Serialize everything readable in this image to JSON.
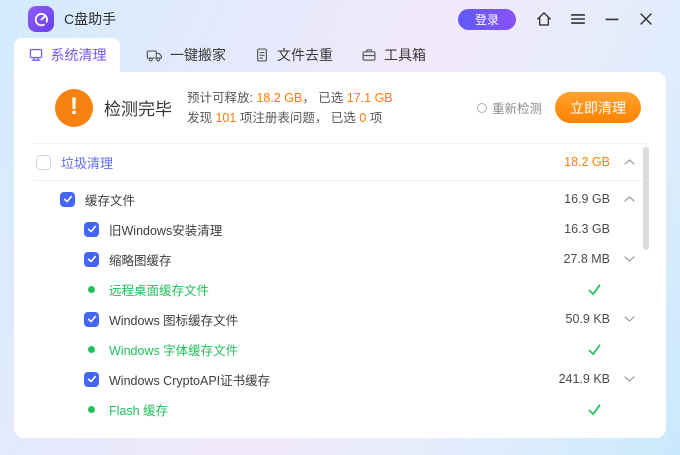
{
  "titlebar": {
    "app_title": "C盘助手",
    "login_label": "登录"
  },
  "tabs": [
    {
      "label": "系统清理"
    },
    {
      "label": "一键搬家"
    },
    {
      "label": "文件去重"
    },
    {
      "label": "工具箱"
    }
  ],
  "banner": {
    "warn_glyph": "!",
    "status": "检测完毕",
    "line1_prefix": "预计可释放: ",
    "line1_value1": "18.2 GB",
    "line1_mid": "， 已选 ",
    "line1_value2": "17.1 GB",
    "line2_prefix": "发现 ",
    "line2_value1": "101",
    "line2_mid": " 项注册表问题， 已选 ",
    "line2_value2": "0",
    "line2_suffix": " 项",
    "recheck_label": "重新检测",
    "clean_label": "立即清理"
  },
  "group": {
    "label": "垃圾清理",
    "size": "18.2 GB",
    "checked": false
  },
  "rows": [
    {
      "label": "缓存文件",
      "size": "16.9 GB",
      "state": "checked",
      "chevron": "up"
    },
    {
      "label": "旧Windows安装清理",
      "size": "16.3 GB",
      "state": "checked",
      "chevron": "none"
    },
    {
      "label": "缩略图缓存",
      "size": "27.8 MB",
      "state": "checked",
      "chevron": "down"
    },
    {
      "label": "远程桌面缓存文件",
      "state": "done"
    },
    {
      "label": "Windows 图标缓存文件",
      "size": "50.9 KB",
      "state": "checked",
      "chevron": "down"
    },
    {
      "label": "Windows 字体缓存文件",
      "state": "done"
    },
    {
      "label": "Windows CryptoAPI证书缓存",
      "size": "241.9 KB",
      "state": "checked",
      "chevron": "down"
    },
    {
      "label": "Flash 缓存",
      "state": "done"
    }
  ],
  "colors": {
    "accent_purple": "#6C59F3",
    "accent_orange": "#FF8000",
    "success_green": "#21C05B",
    "checkbox_blue": "#4465F5"
  }
}
